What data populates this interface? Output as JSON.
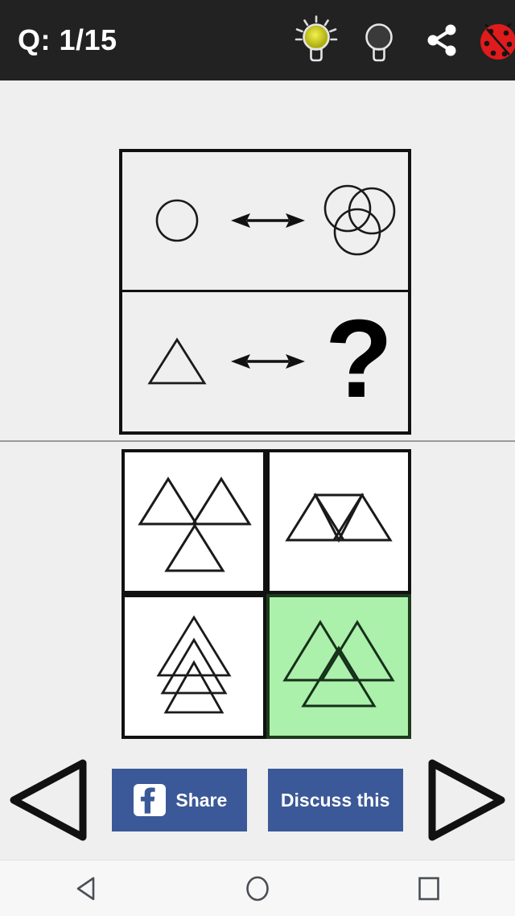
{
  "topbar": {
    "counter_label": "Q: 1/15",
    "background_color": "#222222",
    "text_color": "#ffffff",
    "icons": [
      {
        "name": "hint-bulb-lit-icon",
        "state": "lit",
        "color": "#b6b61c"
      },
      {
        "name": "hint-bulb-unlit-icon",
        "state": "unlit",
        "color": "#3a3a3a"
      },
      {
        "name": "share-icon",
        "state": "default",
        "color": "#ffffff"
      },
      {
        "name": "ladybug-report-icon",
        "state": "default",
        "color": "#e01b1b"
      }
    ]
  },
  "puzzle": {
    "type": "analogy-matrix",
    "frame_border_color": "#111111",
    "background_color": "#efefef",
    "rows": [
      {
        "left_shape": "circle",
        "relation": "double-headed-arrow",
        "right_shape": "three-overlapping-circles"
      },
      {
        "left_shape": "triangle",
        "relation": "double-headed-arrow",
        "right_shape": "question-mark",
        "question_mark": "?"
      }
    ]
  },
  "answers": {
    "selected_index": 3,
    "selected_background": "#abf0ab",
    "default_background": "#ffffff",
    "options": [
      {
        "key": "A",
        "name": "option-three-triangles-pinwheel",
        "shape": "three-triangles-meeting-at-point",
        "selected": false
      },
      {
        "key": "B",
        "name": "option-three-triangles-row",
        "shape": "two-up-one-inverted-row",
        "selected": false
      },
      {
        "key": "C",
        "name": "option-three-triangles-stacked",
        "shape": "nested-stacked-tree",
        "selected": false
      },
      {
        "key": "D",
        "name": "option-three-triangles-overlapping",
        "shape": "three-overlapping-triangles",
        "selected": true
      }
    ]
  },
  "actionbar": {
    "prev_label": "previous-question",
    "next_label": "next-question",
    "share": {
      "label": "Share",
      "icon": "facebook-icon",
      "background_color": "#3b5998",
      "text_color": "#ffffff"
    },
    "discuss": {
      "label": "Discuss this",
      "background_color": "#3b5998",
      "text_color": "#ffffff"
    }
  },
  "navbar": {
    "background_color": "#f7f7f7",
    "buttons": [
      {
        "name": "android-back-button",
        "glyph": "back-triangle-icon"
      },
      {
        "name": "android-home-button",
        "glyph": "home-circle-icon"
      },
      {
        "name": "android-recents-button",
        "glyph": "recents-square-icon"
      }
    ]
  }
}
